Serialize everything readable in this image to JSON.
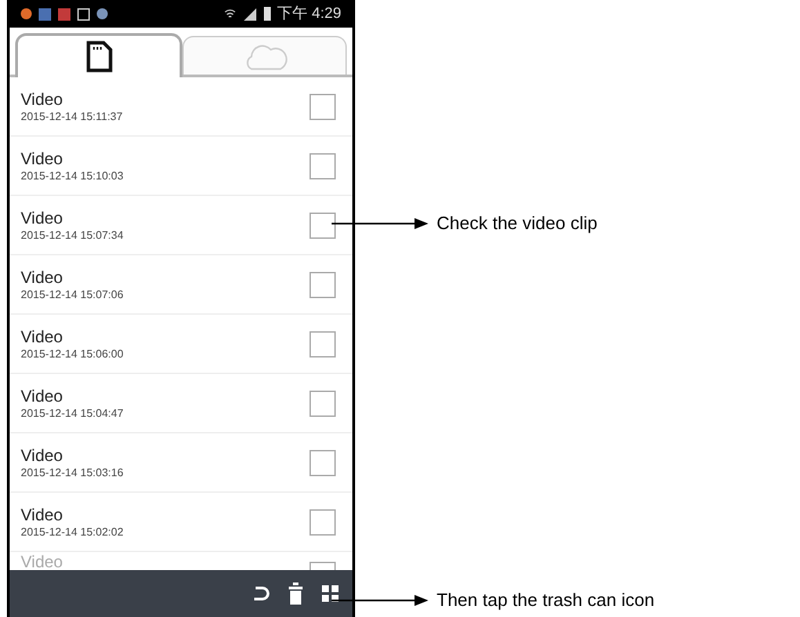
{
  "status_bar": {
    "time": "下午 4:29"
  },
  "tabs": [
    {
      "kind": "sd-card",
      "selected": true
    },
    {
      "kind": "cloud",
      "selected": false
    }
  ],
  "videos": [
    {
      "title": "Video",
      "date": "2015-12-14 15:11:37",
      "checked": false
    },
    {
      "title": "Video",
      "date": "2015-12-14 15:10:03",
      "checked": false
    },
    {
      "title": "Video",
      "date": "2015-12-14 15:07:34",
      "checked": false
    },
    {
      "title": "Video",
      "date": "2015-12-14 15:07:06",
      "checked": false
    },
    {
      "title": "Video",
      "date": "2015-12-14 15:06:00",
      "checked": false
    },
    {
      "title": "Video",
      "date": "2015-12-14 15:04:47",
      "checked": false
    },
    {
      "title": "Video",
      "date": "2015-12-14 15:03:16",
      "checked": false
    },
    {
      "title": "Video",
      "date": "2015-12-14 15:02:02",
      "checked": false
    },
    {
      "title": "Video",
      "checked": false
    }
  ],
  "callouts": [
    {
      "text": "Check the video clip"
    },
    {
      "text": "Then tap the trash can icon"
    }
  ]
}
